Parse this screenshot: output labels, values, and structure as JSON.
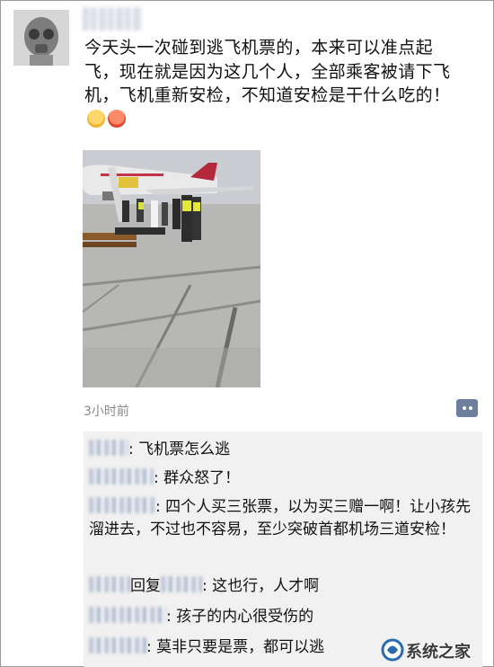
{
  "post": {
    "text": "今天头一次碰到逃飞机票的，本来可以准点起飞，现在就是因为这几个人，全部乘客被请下飞机，飞机重新安检，不知道安检是干什么吃的！",
    "timestamp": "3小时前"
  },
  "comments": [
    {
      "text": ": 飞机票怎么逃"
    },
    {
      "text": ": 群众怒了！"
    },
    {
      "text": ": 四个人买三张票，以为买三赠一啊！让小孩先溜进去，不过也不容易，至少突破首都机场三道安检！"
    },
    {
      "reply_word": "回复",
      "text": ": 这也行，人才啊"
    },
    {
      "text": ": 孩子的内心很受伤的"
    },
    {
      "text": ": 莫非只要是票，都可以逃"
    }
  ],
  "watermark": {
    "text": "系统之家"
  },
  "icons": {
    "more": "comment-more-icon",
    "watermark_logo": "watermark-logo-icon"
  },
  "colors": {
    "accent": "#6c7f9d",
    "meta_text": "#8a8a8a",
    "comment_bg": "#f1f1f1"
  }
}
